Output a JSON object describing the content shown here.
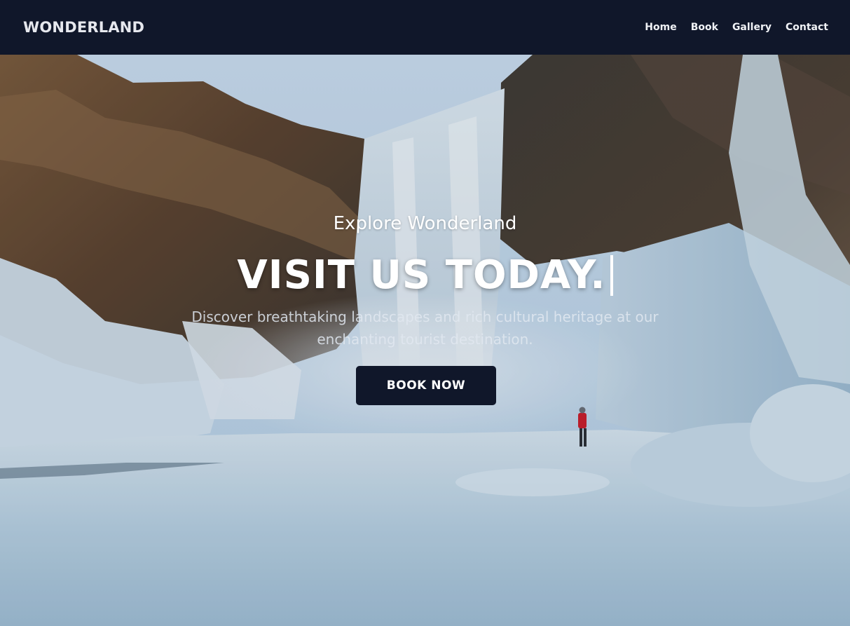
{
  "nav": {
    "brand": "WONDERLAND",
    "links": [
      "Home",
      "Book",
      "Gallery",
      "Contact"
    ]
  },
  "hero": {
    "subtitle": "Explore Wonderland",
    "headline": "VISIT US TODAY.",
    "description": "Discover breathtaking landscapes and rich cultural heritage at our enchanting tourist destination.",
    "cta_label": "BOOK NOW"
  },
  "colors": {
    "nav_background": "#10172a",
    "button_background": "#10172a",
    "text_light": "#ffffff"
  }
}
